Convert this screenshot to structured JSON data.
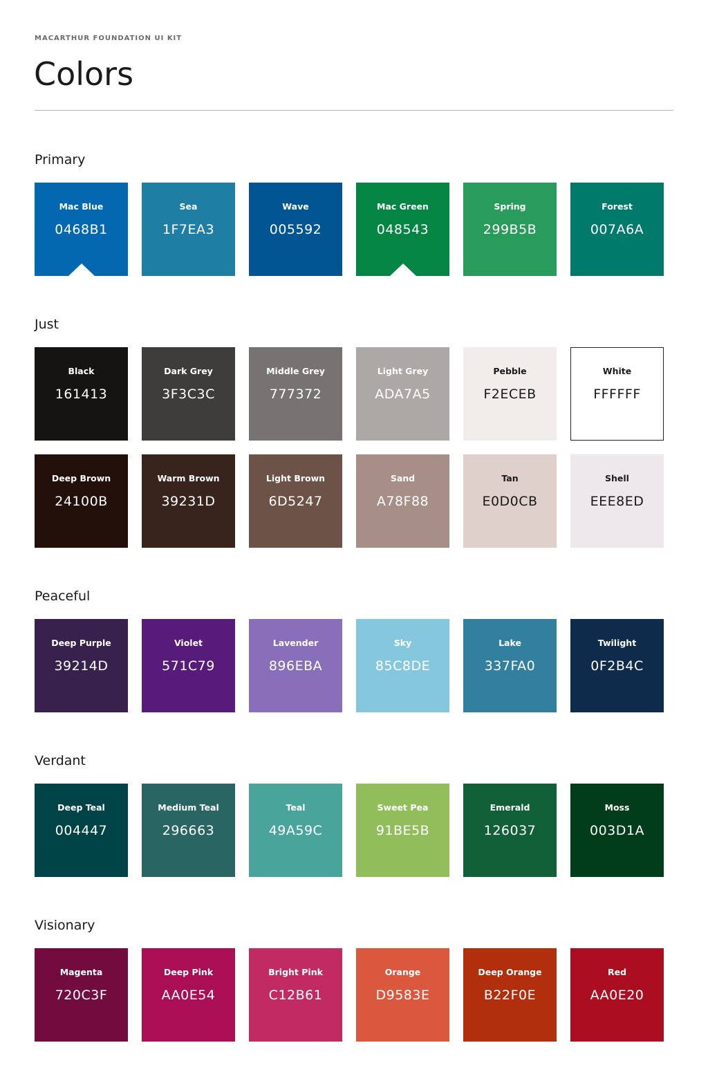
{
  "header": {
    "kit_label": "MACARTHUR FOUNDATION UI KIT",
    "title": "Colors"
  },
  "groups": [
    {
      "heading": "Primary",
      "rows": [
        [
          {
            "name": "Mac Blue",
            "hex": "0468B1",
            "bg": "#0468B1",
            "fg": "#ffffff",
            "selected": true
          },
          {
            "name": "Sea",
            "hex": "1F7EA3",
            "bg": "#1F7EA3",
            "fg": "#ffffff"
          },
          {
            "name": "Wave",
            "hex": "005592",
            "bg": "#005592",
            "fg": "#ffffff"
          },
          {
            "name": "Mac Green",
            "hex": "048543",
            "bg": "#048543",
            "fg": "#ffffff",
            "selected": true
          },
          {
            "name": "Spring",
            "hex": "299B5B",
            "bg": "#299B5B",
            "fg": "#ffffff"
          },
          {
            "name": "Forest",
            "hex": "007A6A",
            "bg": "#007A6A",
            "fg": "#ffffff"
          }
        ]
      ]
    },
    {
      "heading": "Just",
      "rows": [
        [
          {
            "name": "Black",
            "hex": "161413",
            "bg": "#161413",
            "fg": "#ffffff"
          },
          {
            "name": "Dark Grey",
            "hex": "3F3C3C",
            "bg": "#3F3C3C",
            "fg": "#ffffff"
          },
          {
            "name": "Middle Grey",
            "hex": "777372",
            "bg": "#777372",
            "fg": "#ffffff"
          },
          {
            "name": "Light Grey",
            "hex": "ADA7A5",
            "bg": "#ADA7A5",
            "fg": "#ffffff"
          },
          {
            "name": "Pebble",
            "hex": "F2ECEB",
            "bg": "#F2ECEB",
            "fg": "#1a1a1a"
          },
          {
            "name": "White",
            "hex": "FFFFFF",
            "bg": "#FFFFFF",
            "fg": "#1a1a1a",
            "bordered": true
          }
        ],
        [
          {
            "name": "Deep Brown",
            "hex": "24100B",
            "bg": "#24100B",
            "fg": "#ffffff"
          },
          {
            "name": "Warm Brown",
            "hex": "39231D",
            "bg": "#39231D",
            "fg": "#ffffff"
          },
          {
            "name": "Light Brown",
            "hex": "6D5247",
            "bg": "#6D5247",
            "fg": "#ffffff"
          },
          {
            "name": "Sand",
            "hex": "A78F88",
            "bg": "#A78F88",
            "fg": "#ffffff"
          },
          {
            "name": "Tan",
            "hex": "E0D0CB",
            "bg": "#E0D0CB",
            "fg": "#1a1a1a"
          },
          {
            "name": "Shell",
            "hex": "EEE8ED",
            "bg": "#EEE8ED",
            "fg": "#1a1a1a"
          }
        ]
      ]
    },
    {
      "heading": "Peaceful",
      "rows": [
        [
          {
            "name": "Deep Purple",
            "hex": "39214D",
            "bg": "#39214D",
            "fg": "#ffffff"
          },
          {
            "name": "Violet",
            "hex": "571C79",
            "bg": "#571C79",
            "fg": "#ffffff"
          },
          {
            "name": "Lavender",
            "hex": "896EBA",
            "bg": "#896EBA",
            "fg": "#ffffff"
          },
          {
            "name": "Sky",
            "hex": "85C8DE",
            "bg": "#85C8DE",
            "fg": "#ffffff"
          },
          {
            "name": "Lake",
            "hex": "337FA0",
            "bg": "#337FA0",
            "fg": "#ffffff"
          },
          {
            "name": "Twilight",
            "hex": "0F2B4C",
            "bg": "#0F2B4C",
            "fg": "#ffffff"
          }
        ]
      ]
    },
    {
      "heading": "Verdant",
      "rows": [
        [
          {
            "name": "Deep Teal",
            "hex": "004447",
            "bg": "#004447",
            "fg": "#ffffff"
          },
          {
            "name": "Medium Teal",
            "hex": "296663",
            "bg": "#296663",
            "fg": "#ffffff"
          },
          {
            "name": "Teal",
            "hex": "49A59C",
            "bg": "#49A59C",
            "fg": "#ffffff"
          },
          {
            "name": "Sweet Pea",
            "hex": "91BE5B",
            "bg": "#91BE5B",
            "fg": "#ffffff"
          },
          {
            "name": "Emerald",
            "hex": "126037",
            "bg": "#126037",
            "fg": "#ffffff"
          },
          {
            "name": "Moss",
            "hex": "003D1A",
            "bg": "#003D1A",
            "fg": "#ffffff"
          }
        ]
      ]
    },
    {
      "heading": "Visionary",
      "rows": [
        [
          {
            "name": "Magenta",
            "hex": "720C3F",
            "bg": "#720C3F",
            "fg": "#ffffff"
          },
          {
            "name": "Deep Pink",
            "hex": "AA0E54",
            "bg": "#AA0E54",
            "fg": "#ffffff"
          },
          {
            "name": "Bright Pink",
            "hex": "C12B61",
            "bg": "#C12B61",
            "fg": "#ffffff"
          },
          {
            "name": "Orange",
            "hex": "D9583E",
            "bg": "#D9583E",
            "fg": "#ffffff"
          },
          {
            "name": "Deep Orange",
            "hex": "B22F0E",
            "bg": "#B22F0E",
            "fg": "#ffffff"
          },
          {
            "name": "Red",
            "hex": "AA0E20",
            "bg": "#AA0E20",
            "fg": "#ffffff"
          }
        ]
      ]
    }
  ]
}
